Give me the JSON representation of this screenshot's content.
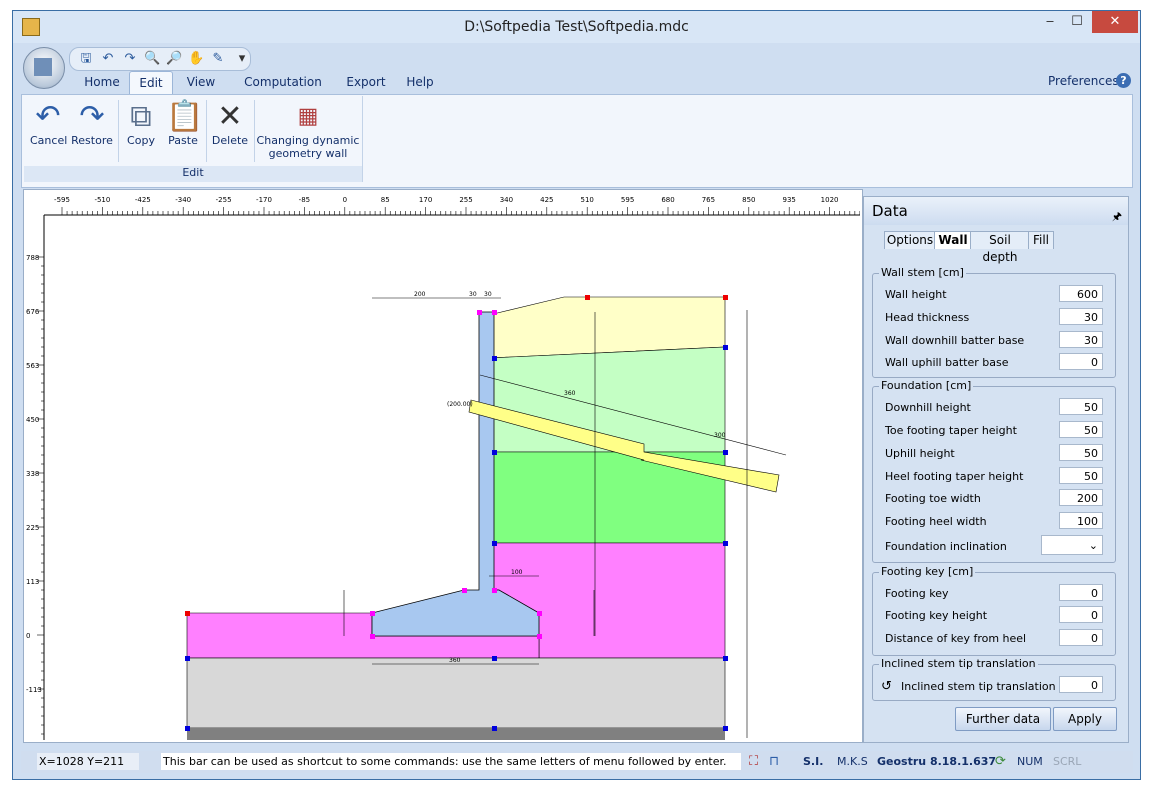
{
  "window": {
    "title": "D:\\Softpedia Test\\Softpedia.mdc",
    "min": "‒",
    "max": "☐",
    "close": "✕"
  },
  "menu": {
    "tabs": [
      "Home",
      "Edit",
      "View",
      "Computation",
      "Export",
      "Help"
    ],
    "active": "Edit",
    "preferences": "Preferences",
    "help_icon": "?"
  },
  "ribbon": {
    "group_label": "Edit",
    "buttons": [
      {
        "label": "Cancel",
        "icon": "undo-icon"
      },
      {
        "label": "Restore",
        "icon": "redo-icon"
      },
      {
        "label": "Copy",
        "icon": "copy-icon"
      },
      {
        "label": "Paste",
        "icon": "paste-icon"
      },
      {
        "label": "Delete",
        "icon": "delete-icon"
      },
      {
        "label": "Changing dynamic geometry wall",
        "icon": "geometry-wall-icon"
      }
    ]
  },
  "canvas": {
    "x_ticks": [
      "-595",
      "-510",
      "-425",
      "-340",
      "-255",
      "-170",
      "-85",
      "0",
      "85",
      "170",
      "255",
      "340",
      "425",
      "510",
      "595",
      "680",
      "765",
      "850",
      "935",
      "1020"
    ],
    "y_ticks": [
      "788",
      "676",
      "563",
      "450",
      "338",
      "225",
      "113",
      "0",
      "-113"
    ],
    "dim_labels": {
      "top_200": "200",
      "top_30a": "30",
      "top_30b": "30",
      "len_360": "360",
      "len_300": "300",
      "neg_200": "(200.00)",
      "toe_100": "100",
      "base_360": "360"
    }
  },
  "data_panel": {
    "title": "Data",
    "pin": "🖈",
    "tabs": [
      "Options",
      "Wall",
      "Soil depth",
      "Fill"
    ],
    "active_tab": "Wall",
    "wall_stem": {
      "title": "Wall stem [cm]",
      "fields": [
        {
          "label": "Wall height",
          "value": "600"
        },
        {
          "label": "Head thickness",
          "value": "30"
        },
        {
          "label": "Wall downhill batter base",
          "value": "30"
        },
        {
          "label": "Wall uphill batter base",
          "value": "0"
        }
      ]
    },
    "foundation": {
      "title": "Foundation [cm]",
      "fields": [
        {
          "label": "Downhill height",
          "value": "50"
        },
        {
          "label": "Toe footing taper height",
          "value": "50"
        },
        {
          "label": "Uphill height",
          "value": "50"
        },
        {
          "label": "Heel footing taper height",
          "value": "50"
        },
        {
          "label": "Footing toe width",
          "value": "200"
        },
        {
          "label": "Footing heel width",
          "value": "100"
        }
      ],
      "inclination_label": "Foundation inclination",
      "inclination_value": ""
    },
    "footing_key": {
      "title": "Footing key [cm]",
      "fields": [
        {
          "label": "Footing key",
          "value": "0"
        },
        {
          "label": "Footing key height",
          "value": "0"
        },
        {
          "label": "Distance of key from heel",
          "value": "0"
        }
      ]
    },
    "inclined": {
      "title": "Inclined stem tip translation",
      "label": "Inclined stem tip translation",
      "value": "0"
    },
    "further": "Further data",
    "apply": "Apply"
  },
  "status": {
    "coords": "X=1028  Y=211",
    "hint": "This bar can be used as shortcut to some commands: use the same letters of menu followed by enter.",
    "units1": "S.I.",
    "units2": "M.K.S",
    "version": "Geostru 8.18.1.637",
    "num": "NUM",
    "scrl": "SCRL"
  }
}
